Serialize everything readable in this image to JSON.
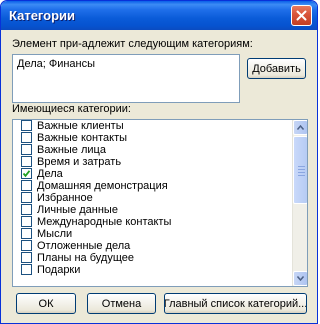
{
  "window": {
    "title": "Категории"
  },
  "assigned": {
    "label": "Элемент при-адлежит следующим категориям:",
    "value": "Дела; Финансы",
    "add_button": "Добавить"
  },
  "available": {
    "label": "Имеющиеся категории:",
    "items": [
      {
        "label": "Важные клиенты",
        "checked": false
      },
      {
        "label": "Важные контакты",
        "checked": false
      },
      {
        "label": "Важные лица",
        "checked": false
      },
      {
        "label": "Время и затрать",
        "checked": false
      },
      {
        "label": "Дела",
        "checked": true
      },
      {
        "label": "Домашняя демонстрация",
        "checked": false
      },
      {
        "label": "Избранное",
        "checked": false
      },
      {
        "label": "Личные данные",
        "checked": false
      },
      {
        "label": "Международные контакты",
        "checked": false
      },
      {
        "label": "Мысли",
        "checked": false
      },
      {
        "label": "Отложенные дела",
        "checked": false
      },
      {
        "label": "Планы на будущее",
        "checked": false
      },
      {
        "label": "Подарки",
        "checked": false
      }
    ]
  },
  "footer": {
    "ok": "ОК",
    "cancel": "Отмена",
    "master_list": "Главный список категорий..."
  },
  "colors": {
    "titlebar": "#0a5bd8",
    "face": "#ece9d8",
    "check": "#21a121"
  }
}
